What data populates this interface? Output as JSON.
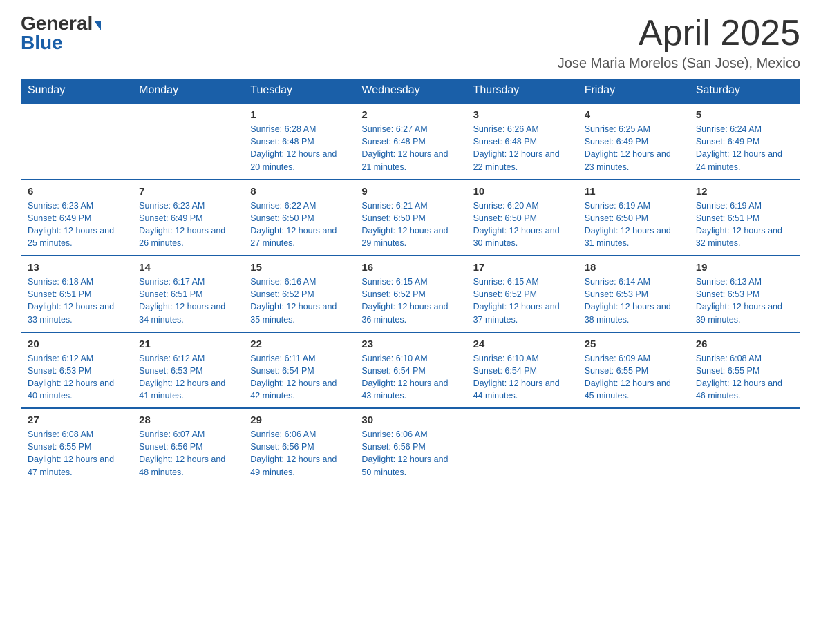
{
  "logo": {
    "general": "General",
    "blue": "Blue"
  },
  "title": "April 2025",
  "subtitle": "Jose Maria Morelos (San Jose), Mexico",
  "days_of_week": [
    "Sunday",
    "Monday",
    "Tuesday",
    "Wednesday",
    "Thursday",
    "Friday",
    "Saturday"
  ],
  "weeks": [
    [
      {
        "day": "",
        "info": ""
      },
      {
        "day": "",
        "info": ""
      },
      {
        "day": "1",
        "info": "Sunrise: 6:28 AM\nSunset: 6:48 PM\nDaylight: 12 hours and 20 minutes."
      },
      {
        "day": "2",
        "info": "Sunrise: 6:27 AM\nSunset: 6:48 PM\nDaylight: 12 hours and 21 minutes."
      },
      {
        "day": "3",
        "info": "Sunrise: 6:26 AM\nSunset: 6:48 PM\nDaylight: 12 hours and 22 minutes."
      },
      {
        "day": "4",
        "info": "Sunrise: 6:25 AM\nSunset: 6:49 PM\nDaylight: 12 hours and 23 minutes."
      },
      {
        "day": "5",
        "info": "Sunrise: 6:24 AM\nSunset: 6:49 PM\nDaylight: 12 hours and 24 minutes."
      }
    ],
    [
      {
        "day": "6",
        "info": "Sunrise: 6:23 AM\nSunset: 6:49 PM\nDaylight: 12 hours and 25 minutes."
      },
      {
        "day": "7",
        "info": "Sunrise: 6:23 AM\nSunset: 6:49 PM\nDaylight: 12 hours and 26 minutes."
      },
      {
        "day": "8",
        "info": "Sunrise: 6:22 AM\nSunset: 6:50 PM\nDaylight: 12 hours and 27 minutes."
      },
      {
        "day": "9",
        "info": "Sunrise: 6:21 AM\nSunset: 6:50 PM\nDaylight: 12 hours and 29 minutes."
      },
      {
        "day": "10",
        "info": "Sunrise: 6:20 AM\nSunset: 6:50 PM\nDaylight: 12 hours and 30 minutes."
      },
      {
        "day": "11",
        "info": "Sunrise: 6:19 AM\nSunset: 6:50 PM\nDaylight: 12 hours and 31 minutes."
      },
      {
        "day": "12",
        "info": "Sunrise: 6:19 AM\nSunset: 6:51 PM\nDaylight: 12 hours and 32 minutes."
      }
    ],
    [
      {
        "day": "13",
        "info": "Sunrise: 6:18 AM\nSunset: 6:51 PM\nDaylight: 12 hours and 33 minutes."
      },
      {
        "day": "14",
        "info": "Sunrise: 6:17 AM\nSunset: 6:51 PM\nDaylight: 12 hours and 34 minutes."
      },
      {
        "day": "15",
        "info": "Sunrise: 6:16 AM\nSunset: 6:52 PM\nDaylight: 12 hours and 35 minutes."
      },
      {
        "day": "16",
        "info": "Sunrise: 6:15 AM\nSunset: 6:52 PM\nDaylight: 12 hours and 36 minutes."
      },
      {
        "day": "17",
        "info": "Sunrise: 6:15 AM\nSunset: 6:52 PM\nDaylight: 12 hours and 37 minutes."
      },
      {
        "day": "18",
        "info": "Sunrise: 6:14 AM\nSunset: 6:53 PM\nDaylight: 12 hours and 38 minutes."
      },
      {
        "day": "19",
        "info": "Sunrise: 6:13 AM\nSunset: 6:53 PM\nDaylight: 12 hours and 39 minutes."
      }
    ],
    [
      {
        "day": "20",
        "info": "Sunrise: 6:12 AM\nSunset: 6:53 PM\nDaylight: 12 hours and 40 minutes."
      },
      {
        "day": "21",
        "info": "Sunrise: 6:12 AM\nSunset: 6:53 PM\nDaylight: 12 hours and 41 minutes."
      },
      {
        "day": "22",
        "info": "Sunrise: 6:11 AM\nSunset: 6:54 PM\nDaylight: 12 hours and 42 minutes."
      },
      {
        "day": "23",
        "info": "Sunrise: 6:10 AM\nSunset: 6:54 PM\nDaylight: 12 hours and 43 minutes."
      },
      {
        "day": "24",
        "info": "Sunrise: 6:10 AM\nSunset: 6:54 PM\nDaylight: 12 hours and 44 minutes."
      },
      {
        "day": "25",
        "info": "Sunrise: 6:09 AM\nSunset: 6:55 PM\nDaylight: 12 hours and 45 minutes."
      },
      {
        "day": "26",
        "info": "Sunrise: 6:08 AM\nSunset: 6:55 PM\nDaylight: 12 hours and 46 minutes."
      }
    ],
    [
      {
        "day": "27",
        "info": "Sunrise: 6:08 AM\nSunset: 6:55 PM\nDaylight: 12 hours and 47 minutes."
      },
      {
        "day": "28",
        "info": "Sunrise: 6:07 AM\nSunset: 6:56 PM\nDaylight: 12 hours and 48 minutes."
      },
      {
        "day": "29",
        "info": "Sunrise: 6:06 AM\nSunset: 6:56 PM\nDaylight: 12 hours and 49 minutes."
      },
      {
        "day": "30",
        "info": "Sunrise: 6:06 AM\nSunset: 6:56 PM\nDaylight: 12 hours and 50 minutes."
      },
      {
        "day": "",
        "info": ""
      },
      {
        "day": "",
        "info": ""
      },
      {
        "day": "",
        "info": ""
      }
    ]
  ]
}
